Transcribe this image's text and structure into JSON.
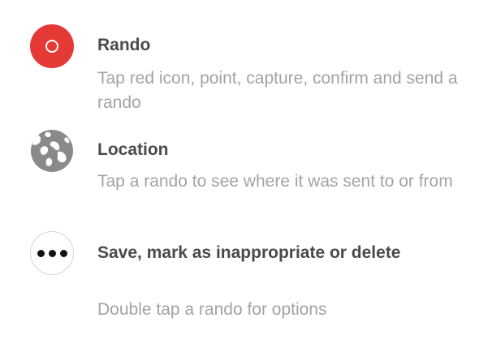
{
  "items": [
    {
      "icon": "record-circle-icon",
      "title": "Rando",
      "description": "Tap red icon, point, capture, confirm and send a rando"
    },
    {
      "icon": "globe-icon",
      "title": "Location",
      "description": "Tap a rando to see where it was sent to or from"
    },
    {
      "icon": "more-dots-icon",
      "title": "Save, mark as inappropriate or delete",
      "description": "Double tap a rando for options"
    }
  ],
  "colors": {
    "accent_red": "#e53935",
    "globe_gray": "#8a8a8a",
    "title_text": "#4a4a4a",
    "description_text": "#a3a3a3"
  }
}
